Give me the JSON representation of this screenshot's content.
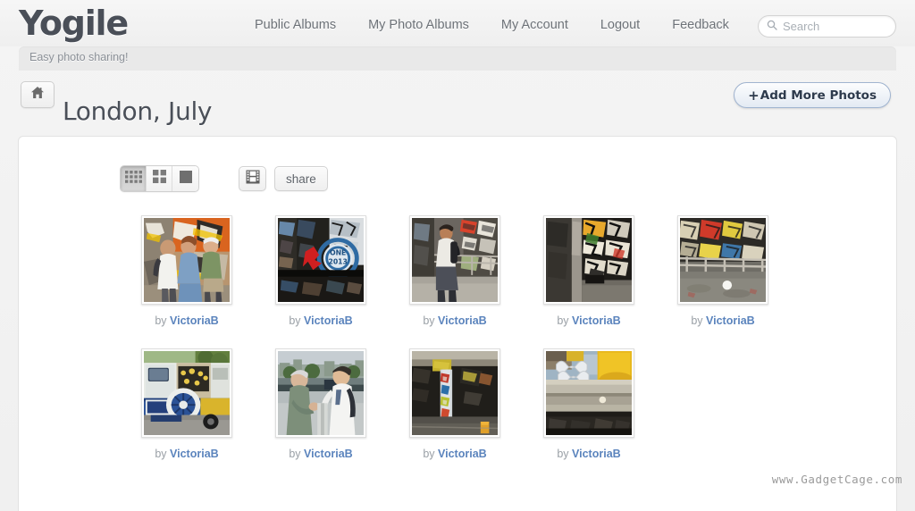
{
  "header": {
    "logo": "Yogile",
    "tagline": "Easy photo sharing!",
    "nav": [
      {
        "label": "Public Albums",
        "name": "nav-public-albums"
      },
      {
        "label": "My Photo Albums",
        "name": "nav-my-photo-albums"
      },
      {
        "label": "My Account",
        "name": "nav-my-account"
      },
      {
        "label": "Logout",
        "name": "nav-logout"
      },
      {
        "label": "Feedback",
        "name": "nav-feedback"
      }
    ],
    "search": {
      "placeholder": "Search",
      "value": "",
      "icon": "search-icon"
    }
  },
  "title_bar": {
    "home_icon": "home-icon",
    "album_title": "London, July",
    "add_photos_plus": "+",
    "add_photos_label": "Add More Photos"
  },
  "toolbar": {
    "view_modes": [
      {
        "name": "view-mode-small-grid",
        "icon": "small-grid-icon",
        "active": true
      },
      {
        "name": "view-mode-medium-grid",
        "icon": "medium-grid-icon",
        "active": false
      },
      {
        "name": "view-mode-single-large",
        "icon": "single-square-icon",
        "active": false
      }
    ],
    "slideshow_icon": "filmstrip-icon",
    "share_label": "share"
  },
  "photos": [
    {
      "caption_prefix": "by",
      "author": "VictoriaB",
      "alt": "Three people standing in front of colorful graffiti wall"
    },
    {
      "caption_prefix": "by",
      "author": "VictoriaB",
      "alt": "Blue circular graffiti tag with red lettering on dark wall"
    },
    {
      "caption_prefix": "by",
      "author": "VictoriaB",
      "alt": "Man with backpack walking past graffiti covered tunnel"
    },
    {
      "caption_prefix": "by",
      "author": "VictoriaB",
      "alt": "Graffiti covered corridor with white tag artwork"
    },
    {
      "caption_prefix": "by",
      "author": "VictoriaB",
      "alt": "Graffiti skate area with white ball on concrete floor"
    },
    {
      "caption_prefix": "by",
      "author": "VictoriaB",
      "alt": "Blue and white ice cream van parked on street"
    },
    {
      "caption_prefix": "by",
      "author": "VictoriaB",
      "alt": "Two men posing by riverside railing with city behind"
    },
    {
      "caption_prefix": "by",
      "author": "VictoriaB",
      "alt": "Graffiti covered pillar under dark concrete underpass"
    },
    {
      "caption_prefix": "by",
      "author": "VictoriaB",
      "alt": "Yellow painted concrete structure with metal sculpture"
    }
  ],
  "watermark": "www.GadgetCage.com",
  "colors": {
    "page_bg": "#f0f0f0",
    "panel_bg": "#ffffff",
    "logo": "#4a4f58",
    "nav_link": "#6d7278",
    "author_link": "#5b84bd",
    "caption": "#9aa0a6",
    "add_button_text": "#2d3a4c"
  }
}
